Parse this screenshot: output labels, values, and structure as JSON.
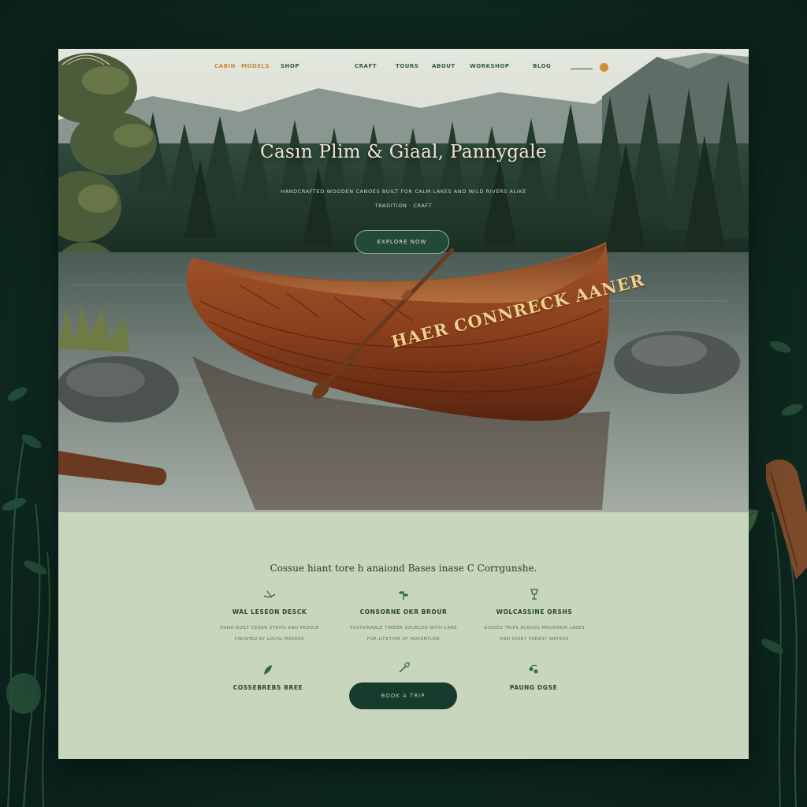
{
  "nav": {
    "links": [
      "CABIN",
      "MODELS",
      "SHOP",
      "CRAFT",
      "TOURS",
      "ABOUT",
      "WORKSHOP",
      "BLOG"
    ]
  },
  "hero": {
    "title": "Casın Plim & Giaal, Pannygale",
    "subtitle_line1": "HANDCRAFTED WOODEN CANOES BUILT FOR CALM LAKES AND WILD RIVERS ALIKE",
    "subtitle_line2": "TRADITION · CRAFT",
    "cta_label": "EXPLORE NOW",
    "canoe_lettering": "HAER CONNRECK AANER"
  },
  "features": {
    "heading": "Cossue hiant tore h anaiond Bases inase C Corrgunshe.",
    "items": [
      {
        "icon": "canoe-icon",
        "title": "WAL LESEON DESCK",
        "desc_line1": "HAND BUILT CEDAR STRIPS AND PADDLE",
        "desc_line2": "FINISHED BY LOCAL MAKERS"
      },
      {
        "icon": "sprout-icon",
        "title": "CONSORNE OKR BROUR",
        "desc_line1": "SUSTAINABLE TIMBER SOURCED WITH CARE",
        "desc_line2": "FOR LIFETIME OF ADVENTURE"
      },
      {
        "icon": "goblet-icon",
        "title": "WOLCASSINE ORSHS",
        "desc_line1": "GUIDED TRIPS ACROSS MOUNTAIN LAKES",
        "desc_line2": "AND QUIET FOREST WATERS"
      },
      {
        "icon": "leaf-icon",
        "title": "COSSEBREBS BREE"
      },
      {
        "icon": "paddle-icon",
        "title": ""
      },
      {
        "icon": "berry-icon",
        "title": "PAUNG DGSE"
      }
    ],
    "cta_label": "BOOK A TRIP"
  },
  "colors": {
    "page_bg": "#c8d6bd",
    "surround": "#0f2a22",
    "accent_orange": "#c78a3e",
    "button_green": "#173b2d"
  }
}
